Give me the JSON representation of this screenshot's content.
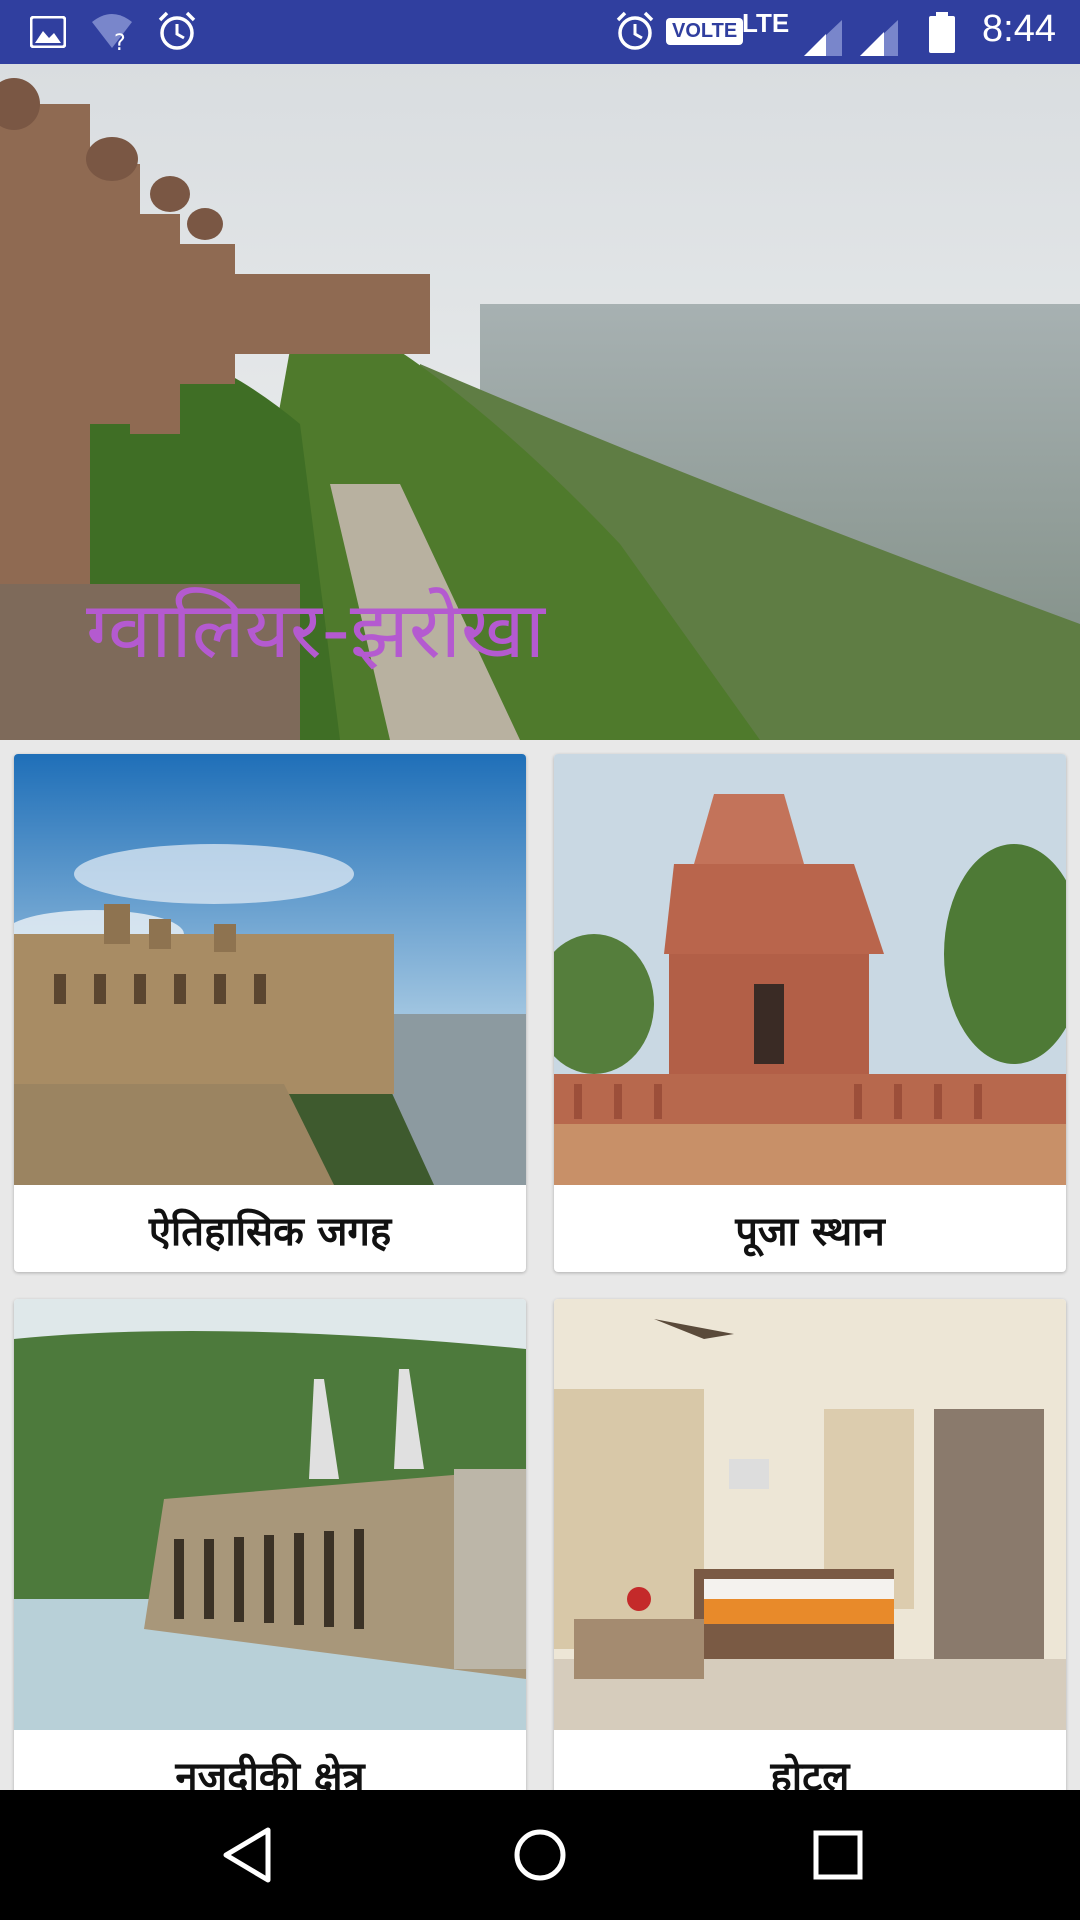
{
  "status_bar": {
    "time": "8:44",
    "network_label": "VOLTE",
    "lte_label": "LTE",
    "icons": [
      "image-icon",
      "wifi-question-icon",
      "alarm-icon",
      "alarm-icon",
      "signal-icon",
      "signal-icon",
      "battery-icon"
    ]
  },
  "hero": {
    "title": "ग्वालियर-झरोखा"
  },
  "categories": [
    {
      "label": "ऐतिहासिक जगह"
    },
    {
      "label": "पूजा स्थान"
    },
    {
      "label": "नजदीकी क्षेत्र"
    },
    {
      "label": "होटल"
    }
  ],
  "nav": {
    "icons": [
      "back-icon",
      "home-icon",
      "recents-icon"
    ]
  },
  "colors": {
    "status_bar": "#303f9f",
    "title_accent": "#b45ad0"
  }
}
